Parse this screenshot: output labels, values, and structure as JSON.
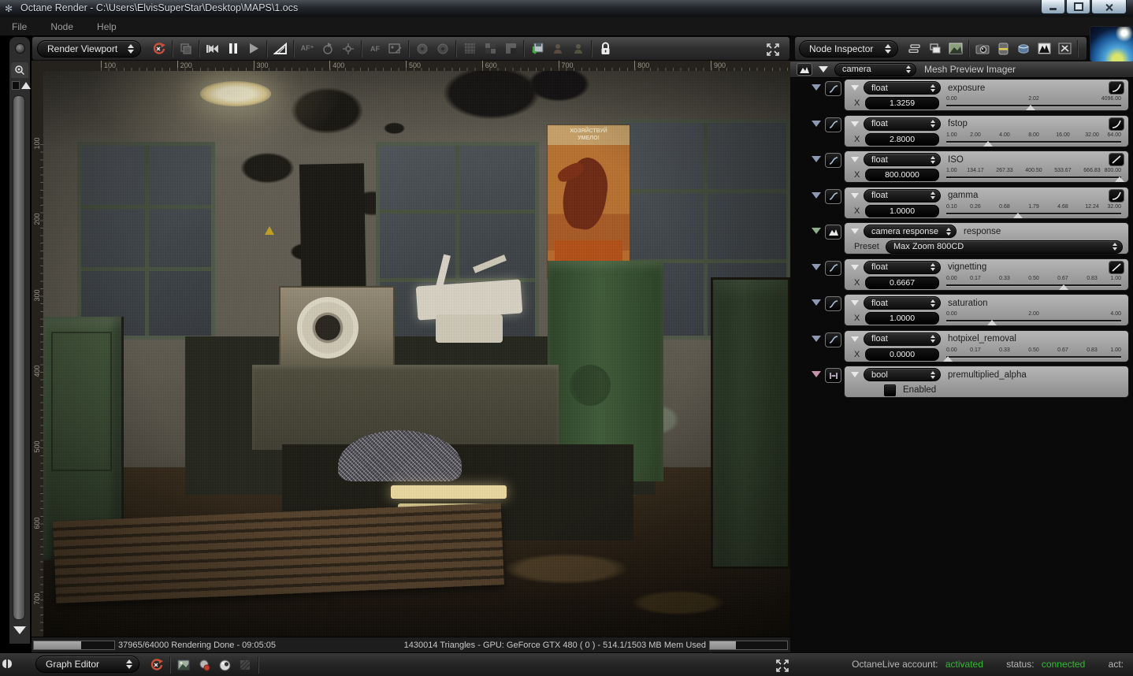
{
  "window": {
    "title": "Octane Render - C:\\Users\\ElvisSuperStar\\Desktop\\MAPS\\1.ocs",
    "menu": {
      "file": "File",
      "node": "Node",
      "help": "Help"
    },
    "window_buttons": [
      "minimize",
      "restore",
      "close"
    ]
  },
  "viewport": {
    "selector_label": "Render Viewport",
    "toolbar_icons": [
      "restart-render-icon",
      "copy-image-icon",
      "rewind-icon",
      "pause-icon",
      "play-icon",
      "film-gamma-icon",
      "autofocus-add-icon",
      "refocus-icon",
      "focus-picker-icon",
      "autofocus-icon",
      "white-balance-picker-icon",
      "render-disc-a-icon",
      "render-disc-b-icon",
      "subsample-fine-icon",
      "subsample-coarse-icon",
      "subsample-half-icon",
      "save-render-icon",
      "compare-a-icon",
      "compare-b-icon",
      "lock-image-icon",
      "expand-viewport-icon"
    ],
    "ruler_h": [
      "100",
      "200",
      "300",
      "400",
      "500",
      "600",
      "700",
      "800",
      "900"
    ],
    "ruler_v": [
      "100",
      "200",
      "300",
      "400",
      "500",
      "600",
      "700"
    ],
    "status": {
      "progress1_pct": 59,
      "render_text": "37965/64000 Rendering Done - 09:05:05",
      "gpu_text": "1430014 Triangles - GPU: GeForce GTX 480 ( 0 ) - 514.1/1503 MB Mem Used",
      "progress2_pct": 34
    }
  },
  "scene": {
    "poster_line1": "ХОЗЯЙСТВУЙ",
    "poster_line2": "УМЕЛО!"
  },
  "graph_editor": {
    "selector_label": "Graph Editor",
    "toolbar_icons": [
      "restart-render-icon",
      "save-image-icon",
      "material-picker-icon",
      "preview-sphere-icon",
      "texture-preview-icon",
      "expand-graph-icon",
      "panel-handle-icon"
    ]
  },
  "octane_live": {
    "account_label": "OctaneLive account:",
    "account_value": "activated",
    "status_label": "status:",
    "status_value": "connected",
    "act_label": "act:",
    "green": "#2ebe2e"
  },
  "inspector": {
    "selector_label": "Node Inspector",
    "toolbar_icons": [
      "collapse-hierarchy-icon",
      "expand-hierarchy-icon",
      "preview-image-icon",
      "camera-icon",
      "exposure-icon",
      "film-settings-icon",
      "histogram-icon",
      "render-settings-icon",
      "octane-logo"
    ],
    "node_type_value": "camera",
    "node_title": "Mesh Preview Imager",
    "params": [
      {
        "kind": "float",
        "type": "float",
        "name": "exposure",
        "x_label": "X",
        "value": "1.3259",
        "ticks": [
          "0.00",
          "2.02",
          "4096.00"
        ],
        "handle_pct": 48,
        "curve": "log",
        "pin_color": "#8b9ab2"
      },
      {
        "kind": "float",
        "type": "float",
        "name": "fstop",
        "x_label": "X",
        "value": "2.8000",
        "ticks": [
          "1.00",
          "2.00",
          "4.00",
          "8.00",
          "16.00",
          "32.00",
          "64.00"
        ],
        "handle_pct": 24,
        "curve": "log",
        "pin_color": "#8b9ab2"
      },
      {
        "kind": "float",
        "type": "float",
        "name": "ISO",
        "x_label": "X",
        "value": "800.0000",
        "ticks": [
          "1.00",
          "134.17",
          "267.33",
          "400.50",
          "533.67",
          "666.83",
          "800.00"
        ],
        "handle_pct": 99,
        "curve": "linear",
        "pin_color": "#8b9ab2"
      },
      {
        "kind": "float",
        "type": "float",
        "name": "gamma",
        "x_label": "X",
        "value": "1.0000",
        "ticks": [
          "0.10",
          "0.26",
          "0.68",
          "1.79",
          "4.68",
          "12.24",
          "32.00"
        ],
        "handle_pct": 41,
        "curve": "log",
        "pin_color": "#8b9ab2"
      },
      {
        "kind": "response",
        "type": "camera response",
        "name": "response",
        "preset_label": "Preset",
        "preset_value": "Max Zoom 800CD",
        "curve": "none",
        "pin_color": "#8fae8b"
      },
      {
        "kind": "float",
        "type": "float",
        "name": "vignetting",
        "x_label": "X",
        "value": "0.6667",
        "ticks": [
          "0.00",
          "0.17",
          "0.33",
          "0.50",
          "0.67",
          "0.83",
          "1.00"
        ],
        "handle_pct": 67,
        "curve": "linear",
        "pin_color": "#8b9ab2"
      },
      {
        "kind": "float",
        "type": "float",
        "name": "saturation",
        "x_label": "X",
        "value": "1.0000",
        "ticks": [
          "0.00",
          "2.00",
          "4.00"
        ],
        "handle_pct": 26,
        "curve": "none",
        "pin_color": "#8b9ab2"
      },
      {
        "kind": "float",
        "type": "float",
        "name": "hotpixel_removal",
        "x_label": "X",
        "value": "0.0000",
        "ticks": [
          "0.00",
          "0.17",
          "0.33",
          "0.50",
          "0.67",
          "0.83",
          "1.00"
        ],
        "handle_pct": 1,
        "curve": "none",
        "pin_color": "#8b9ab2"
      },
      {
        "kind": "bool",
        "type": "bool",
        "name": "premultiplied_alpha",
        "checkbox_label": "Enabled",
        "checked": false,
        "curve": "none",
        "pin_color": "#c492ab"
      }
    ]
  }
}
